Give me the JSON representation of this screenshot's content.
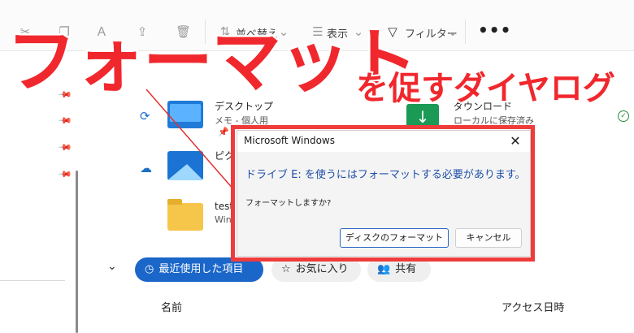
{
  "toolbar": {
    "sort_label": "並べ替え",
    "view_label": "表示",
    "filter_label": "フィルター",
    "more_label": "•••"
  },
  "files": [
    {
      "name": "デスクトップ",
      "sub": "メモ - 個人用"
    },
    {
      "name": "ピクチャ",
      "sub": ""
    },
    {
      "name": "test",
      "sub": "Win"
    },
    {
      "name": "ダウンロード",
      "sub": "ローカルに保存済み"
    }
  ],
  "quick_access": {
    "recent_label": "最近使用した項目",
    "favorites_label": "お気に入り",
    "shared_label": "共有"
  },
  "columns": {
    "name": "名前",
    "access_date": "アクセス日時"
  },
  "overlay": {
    "title": "フォーマット",
    "subtitle": "を促すダイヤログ"
  },
  "dialog": {
    "title": "Microsoft Windows",
    "close": "✕",
    "heading": "ドライブ E: を使うにはフォーマットする必要があります。",
    "question": "フォーマットしますか?",
    "format_button": "ディスクのフォーマット",
    "cancel_button": "キャンセル"
  },
  "colors": {
    "accent": "#1b66c9",
    "annotation_red": "#f0282d",
    "heading_blue": "#1f4fa8"
  }
}
